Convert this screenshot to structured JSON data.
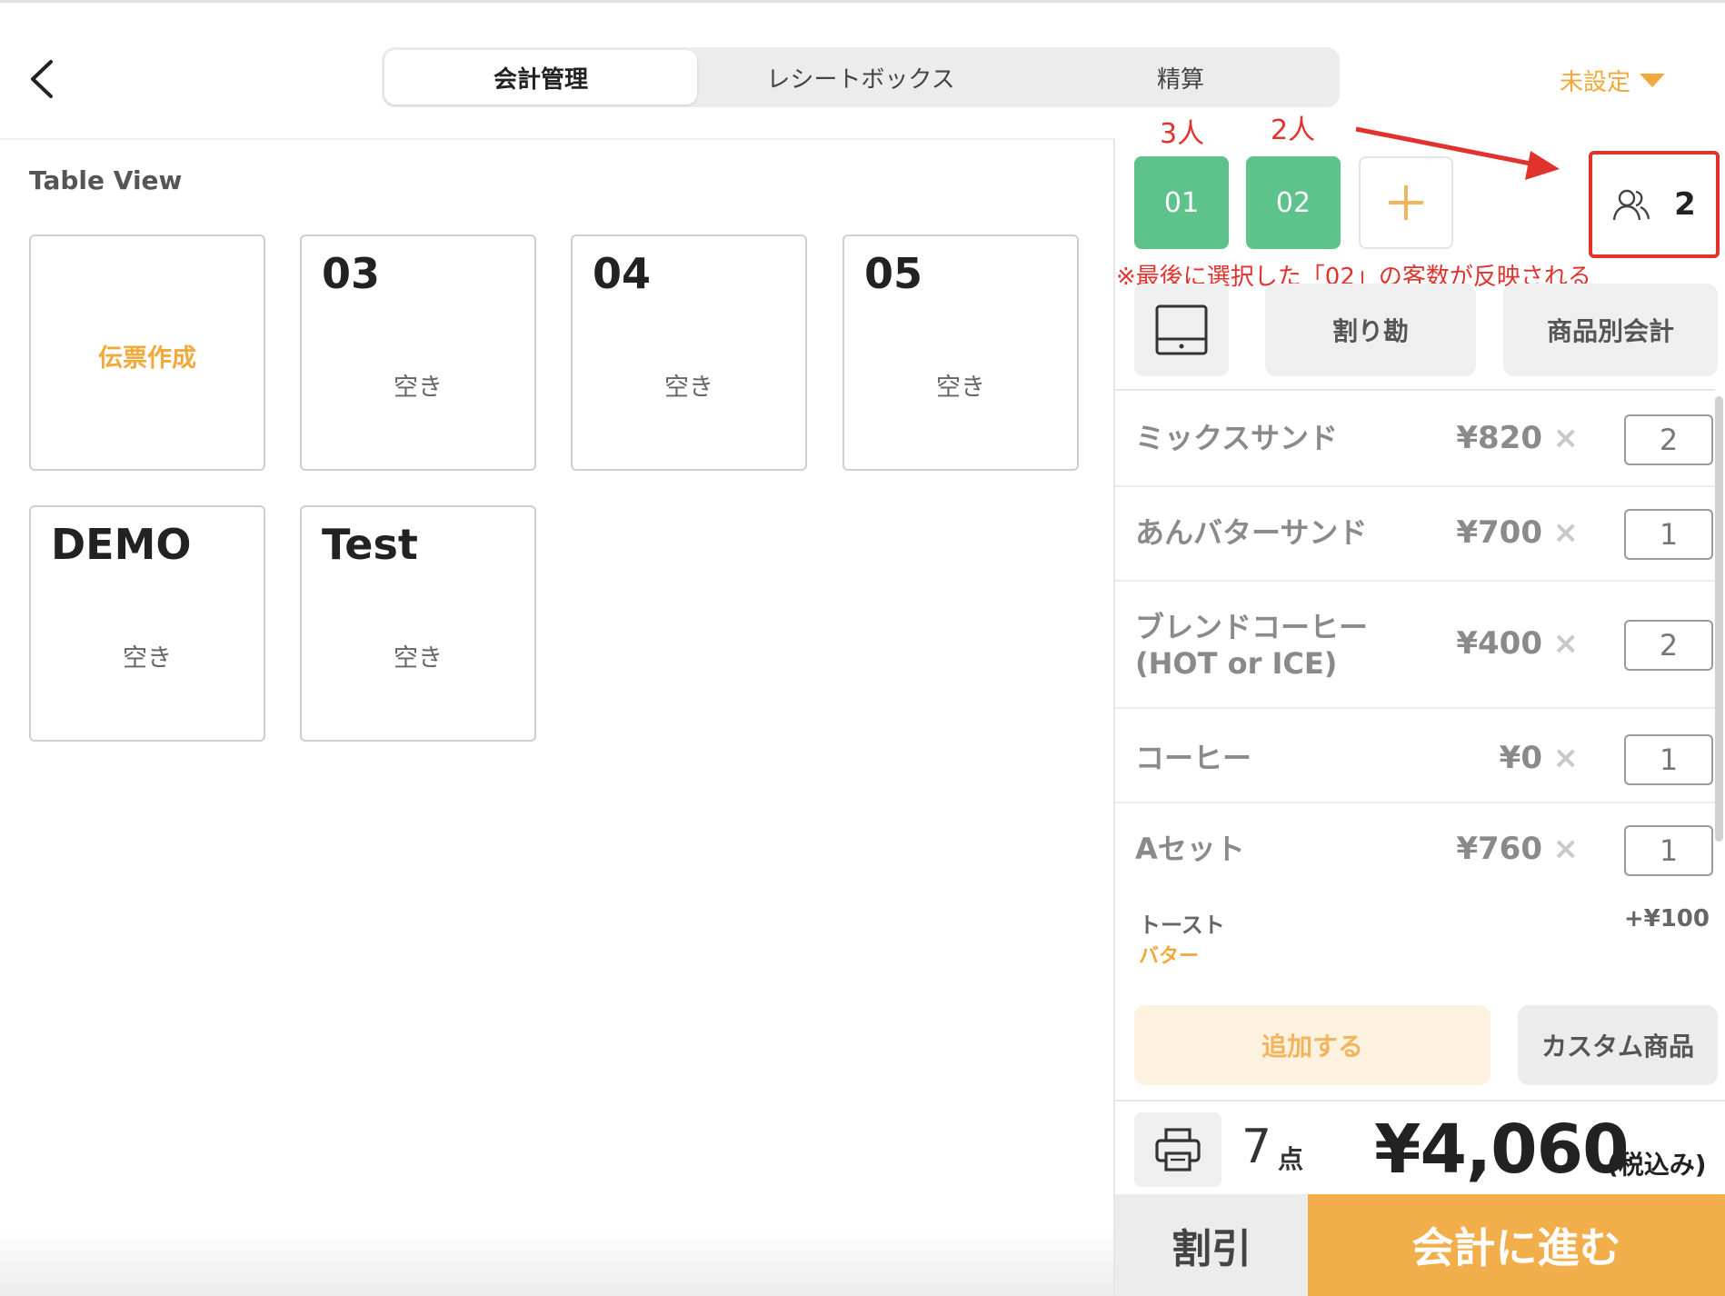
{
  "header": {
    "tabs": [
      {
        "label": "会計管理",
        "active": true
      },
      {
        "label": "レシートボックス",
        "active": false
      },
      {
        "label": "精算",
        "active": false
      }
    ],
    "staff_select": "未設定"
  },
  "table_view": {
    "title": "Table View",
    "create_slip": "伝票作成",
    "tables": [
      {
        "name": "03",
        "status": "空き"
      },
      {
        "name": "04",
        "status": "空き"
      },
      {
        "name": "05",
        "status": "空き"
      },
      {
        "name": "DEMO",
        "status": "空き"
      },
      {
        "name": "Test",
        "status": "空き"
      }
    ]
  },
  "right_panel": {
    "split_bills": [
      "01",
      "02"
    ],
    "guest_count": "2",
    "buttons": {
      "split": "割り勘",
      "by_item": "商品別会計",
      "add": "追加する",
      "custom": "カスタム商品",
      "discount": "割引",
      "checkout": "会計に進む"
    },
    "order_items": [
      {
        "name": "ミックスサンド",
        "price": "¥820",
        "x": "×",
        "qty": "2"
      },
      {
        "name": "あんバターサンド",
        "price": "¥700",
        "x": "×",
        "qty": "1"
      },
      {
        "name": "ブレンドコーヒー",
        "name2": "(HOT or ICE)",
        "price": "¥400",
        "x": "×",
        "qty": "2"
      },
      {
        "name": "コーヒー",
        "price": "¥0",
        "x": "×",
        "qty": "1"
      },
      {
        "name": "Aセット",
        "price": "¥760",
        "x": "×",
        "qty": "1"
      }
    ],
    "set_option": {
      "name": "トースト",
      "option": "バター",
      "price": "+¥100"
    },
    "summary": {
      "count": "7",
      "unit": "点",
      "total": "¥4,060",
      "tax_note": "(税込み)"
    }
  },
  "annotations": {
    "people_01": "3人",
    "people_02": "2人",
    "note": "※最後に選択した「02」の客数が反映される"
  },
  "colors": {
    "accent_orange": "#f2a93b",
    "split_green": "#5ec28b",
    "annotation_red": "#e0332e"
  }
}
